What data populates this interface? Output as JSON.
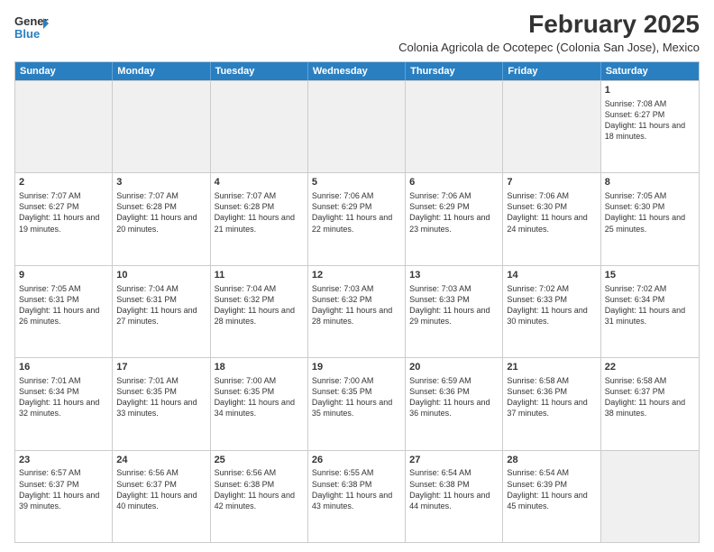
{
  "logo": {
    "general": "General",
    "blue": "Blue"
  },
  "title": "February 2025",
  "location": "Colonia Agricola de Ocotepec (Colonia San Jose), Mexico",
  "days_of_week": [
    "Sunday",
    "Monday",
    "Tuesday",
    "Wednesday",
    "Thursday",
    "Friday",
    "Saturday"
  ],
  "weeks": [
    [
      {
        "day": "",
        "info": ""
      },
      {
        "day": "",
        "info": ""
      },
      {
        "day": "",
        "info": ""
      },
      {
        "day": "",
        "info": ""
      },
      {
        "day": "",
        "info": ""
      },
      {
        "day": "",
        "info": ""
      },
      {
        "day": "1",
        "info": "Sunrise: 7:08 AM\nSunset: 6:27 PM\nDaylight: 11 hours and 18 minutes."
      }
    ],
    [
      {
        "day": "2",
        "info": "Sunrise: 7:07 AM\nSunset: 6:27 PM\nDaylight: 11 hours and 19 minutes."
      },
      {
        "day": "3",
        "info": "Sunrise: 7:07 AM\nSunset: 6:28 PM\nDaylight: 11 hours and 20 minutes."
      },
      {
        "day": "4",
        "info": "Sunrise: 7:07 AM\nSunset: 6:28 PM\nDaylight: 11 hours and 21 minutes."
      },
      {
        "day": "5",
        "info": "Sunrise: 7:06 AM\nSunset: 6:29 PM\nDaylight: 11 hours and 22 minutes."
      },
      {
        "day": "6",
        "info": "Sunrise: 7:06 AM\nSunset: 6:29 PM\nDaylight: 11 hours and 23 minutes."
      },
      {
        "day": "7",
        "info": "Sunrise: 7:06 AM\nSunset: 6:30 PM\nDaylight: 11 hours and 24 minutes."
      },
      {
        "day": "8",
        "info": "Sunrise: 7:05 AM\nSunset: 6:30 PM\nDaylight: 11 hours and 25 minutes."
      }
    ],
    [
      {
        "day": "9",
        "info": "Sunrise: 7:05 AM\nSunset: 6:31 PM\nDaylight: 11 hours and 26 minutes."
      },
      {
        "day": "10",
        "info": "Sunrise: 7:04 AM\nSunset: 6:31 PM\nDaylight: 11 hours and 27 minutes."
      },
      {
        "day": "11",
        "info": "Sunrise: 7:04 AM\nSunset: 6:32 PM\nDaylight: 11 hours and 28 minutes."
      },
      {
        "day": "12",
        "info": "Sunrise: 7:03 AM\nSunset: 6:32 PM\nDaylight: 11 hours and 28 minutes."
      },
      {
        "day": "13",
        "info": "Sunrise: 7:03 AM\nSunset: 6:33 PM\nDaylight: 11 hours and 29 minutes."
      },
      {
        "day": "14",
        "info": "Sunrise: 7:02 AM\nSunset: 6:33 PM\nDaylight: 11 hours and 30 minutes."
      },
      {
        "day": "15",
        "info": "Sunrise: 7:02 AM\nSunset: 6:34 PM\nDaylight: 11 hours and 31 minutes."
      }
    ],
    [
      {
        "day": "16",
        "info": "Sunrise: 7:01 AM\nSunset: 6:34 PM\nDaylight: 11 hours and 32 minutes."
      },
      {
        "day": "17",
        "info": "Sunrise: 7:01 AM\nSunset: 6:35 PM\nDaylight: 11 hours and 33 minutes."
      },
      {
        "day": "18",
        "info": "Sunrise: 7:00 AM\nSunset: 6:35 PM\nDaylight: 11 hours and 34 minutes."
      },
      {
        "day": "19",
        "info": "Sunrise: 7:00 AM\nSunset: 6:35 PM\nDaylight: 11 hours and 35 minutes."
      },
      {
        "day": "20",
        "info": "Sunrise: 6:59 AM\nSunset: 6:36 PM\nDaylight: 11 hours and 36 minutes."
      },
      {
        "day": "21",
        "info": "Sunrise: 6:58 AM\nSunset: 6:36 PM\nDaylight: 11 hours and 37 minutes."
      },
      {
        "day": "22",
        "info": "Sunrise: 6:58 AM\nSunset: 6:37 PM\nDaylight: 11 hours and 38 minutes."
      }
    ],
    [
      {
        "day": "23",
        "info": "Sunrise: 6:57 AM\nSunset: 6:37 PM\nDaylight: 11 hours and 39 minutes."
      },
      {
        "day": "24",
        "info": "Sunrise: 6:56 AM\nSunset: 6:37 PM\nDaylight: 11 hours and 40 minutes."
      },
      {
        "day": "25",
        "info": "Sunrise: 6:56 AM\nSunset: 6:38 PM\nDaylight: 11 hours and 42 minutes."
      },
      {
        "day": "26",
        "info": "Sunrise: 6:55 AM\nSunset: 6:38 PM\nDaylight: 11 hours and 43 minutes."
      },
      {
        "day": "27",
        "info": "Sunrise: 6:54 AM\nSunset: 6:38 PM\nDaylight: 11 hours and 44 minutes."
      },
      {
        "day": "28",
        "info": "Sunrise: 6:54 AM\nSunset: 6:39 PM\nDaylight: 11 hours and 45 minutes."
      },
      {
        "day": "",
        "info": ""
      }
    ]
  ]
}
